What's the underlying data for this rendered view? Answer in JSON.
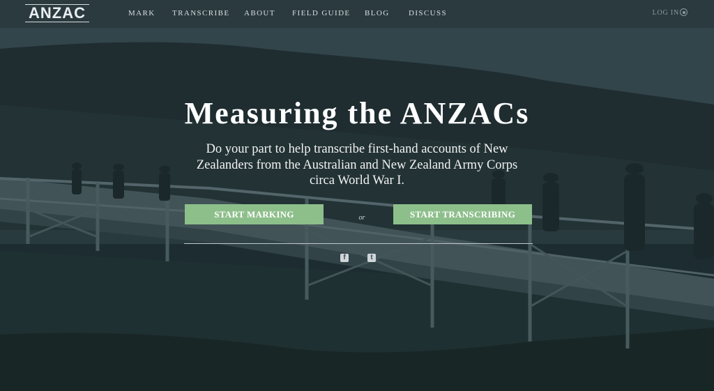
{
  "header": {
    "logo_text": "ANZAC",
    "nav": [
      "MARK",
      "TRANSCRIBE",
      "ABOUT",
      "FIELD GUIDE",
      "BLOG",
      "DISCUSS"
    ],
    "login_label": "LOG IN"
  },
  "hero": {
    "title": "Measuring the ANZACs",
    "subtitle": "Do your part to help transcribe first-hand accounts of New Zealanders from the Australian and New Zealand Army Corps circa World War I.",
    "start_marking": "START MARKING",
    "or_text": "or",
    "start_transcribing": "START TRANSCRIBING"
  },
  "social": {
    "icons": [
      "facebook-icon",
      "twitter-icon"
    ],
    "facebook_glyph": "f",
    "twitter_glyph": "t"
  },
  "colors": {
    "topbar": "#2c3a40",
    "button": "#8dbf8b",
    "overlay": "#26363b"
  }
}
